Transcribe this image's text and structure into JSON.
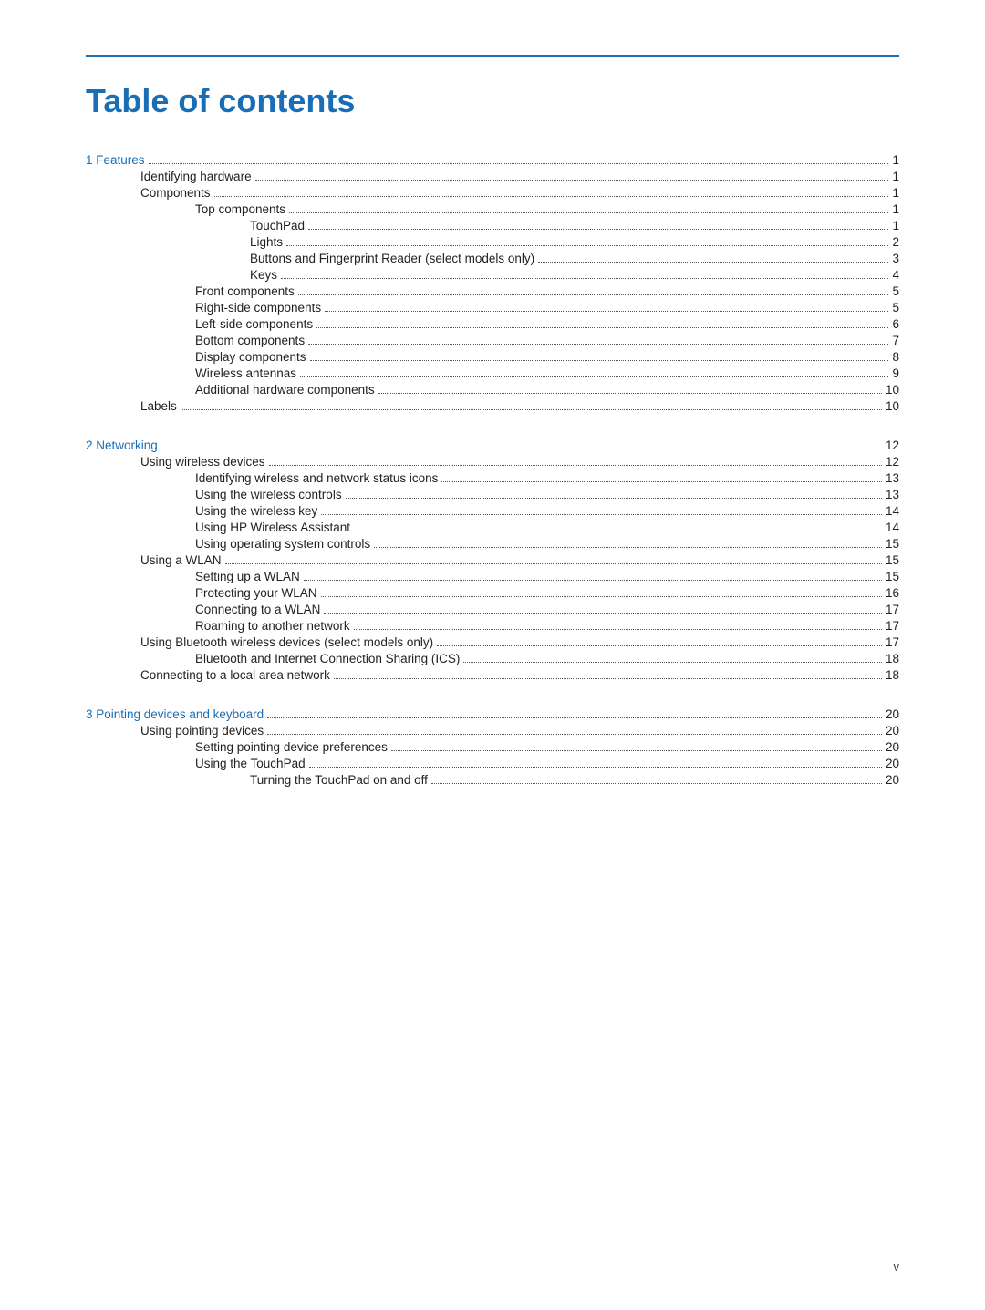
{
  "title": "Table of contents",
  "sections": [
    {
      "id": "section-1",
      "chapter": "1",
      "label": "Features",
      "page": "1",
      "entries": [
        {
          "level": 1,
          "text": "Identifying hardware",
          "page": "1"
        },
        {
          "level": 1,
          "text": "Components",
          "page": "1"
        },
        {
          "level": 2,
          "text": "Top components",
          "page": "1"
        },
        {
          "level": 3,
          "text": "TouchPad",
          "page": "1"
        },
        {
          "level": 3,
          "text": "Lights",
          "page": "2"
        },
        {
          "level": 3,
          "text": "Buttons and Fingerprint Reader (select models only)",
          "page": "3"
        },
        {
          "level": 3,
          "text": "Keys",
          "page": "4"
        },
        {
          "level": 2,
          "text": "Front components",
          "page": "5"
        },
        {
          "level": 2,
          "text": "Right-side components",
          "page": "5"
        },
        {
          "level": 2,
          "text": "Left-side components",
          "page": "6"
        },
        {
          "level": 2,
          "text": "Bottom components",
          "page": "7"
        },
        {
          "level": 2,
          "text": "Display components",
          "page": "8"
        },
        {
          "level": 2,
          "text": "Wireless antennas",
          "page": "9"
        },
        {
          "level": 2,
          "text": "Additional hardware components",
          "page": "10"
        },
        {
          "level": 1,
          "text": "Labels",
          "page": "10"
        }
      ]
    },
    {
      "id": "section-2",
      "chapter": "2",
      "label": "Networking",
      "page": "12",
      "entries": [
        {
          "level": 1,
          "text": "Using wireless devices",
          "page": "12"
        },
        {
          "level": 2,
          "text": "Identifying wireless and network status icons",
          "page": "13"
        },
        {
          "level": 2,
          "text": "Using the wireless controls",
          "page": "13"
        },
        {
          "level": 2,
          "text": "Using the wireless key",
          "page": "14"
        },
        {
          "level": 2,
          "text": "Using HP Wireless Assistant",
          "page": "14"
        },
        {
          "level": 2,
          "text": "Using operating system controls",
          "page": "15"
        },
        {
          "level": 1,
          "text": "Using a WLAN",
          "page": "15"
        },
        {
          "level": 2,
          "text": "Setting up a WLAN",
          "page": "15"
        },
        {
          "level": 2,
          "text": "Protecting your WLAN",
          "page": "16"
        },
        {
          "level": 2,
          "text": "Connecting to a WLAN",
          "page": "17"
        },
        {
          "level": 2,
          "text": "Roaming to another network",
          "page": "17"
        },
        {
          "level": 1,
          "text": "Using Bluetooth wireless devices (select models only)",
          "page": "17"
        },
        {
          "level": 2,
          "text": "Bluetooth and Internet Connection Sharing (ICS)",
          "page": "18"
        },
        {
          "level": 1,
          "text": "Connecting to a local area network",
          "page": "18"
        }
      ]
    },
    {
      "id": "section-3",
      "chapter": "3",
      "label": "Pointing devices and keyboard",
      "page": "20",
      "entries": [
        {
          "level": 1,
          "text": "Using pointing devices",
          "page": "20"
        },
        {
          "level": 2,
          "text": "Setting pointing device preferences",
          "page": "20"
        },
        {
          "level": 2,
          "text": "Using the TouchPad",
          "page": "20"
        },
        {
          "level": 3,
          "text": "Turning the TouchPad on and off",
          "page": "20"
        }
      ]
    }
  ],
  "footer": {
    "page_label": "v"
  }
}
